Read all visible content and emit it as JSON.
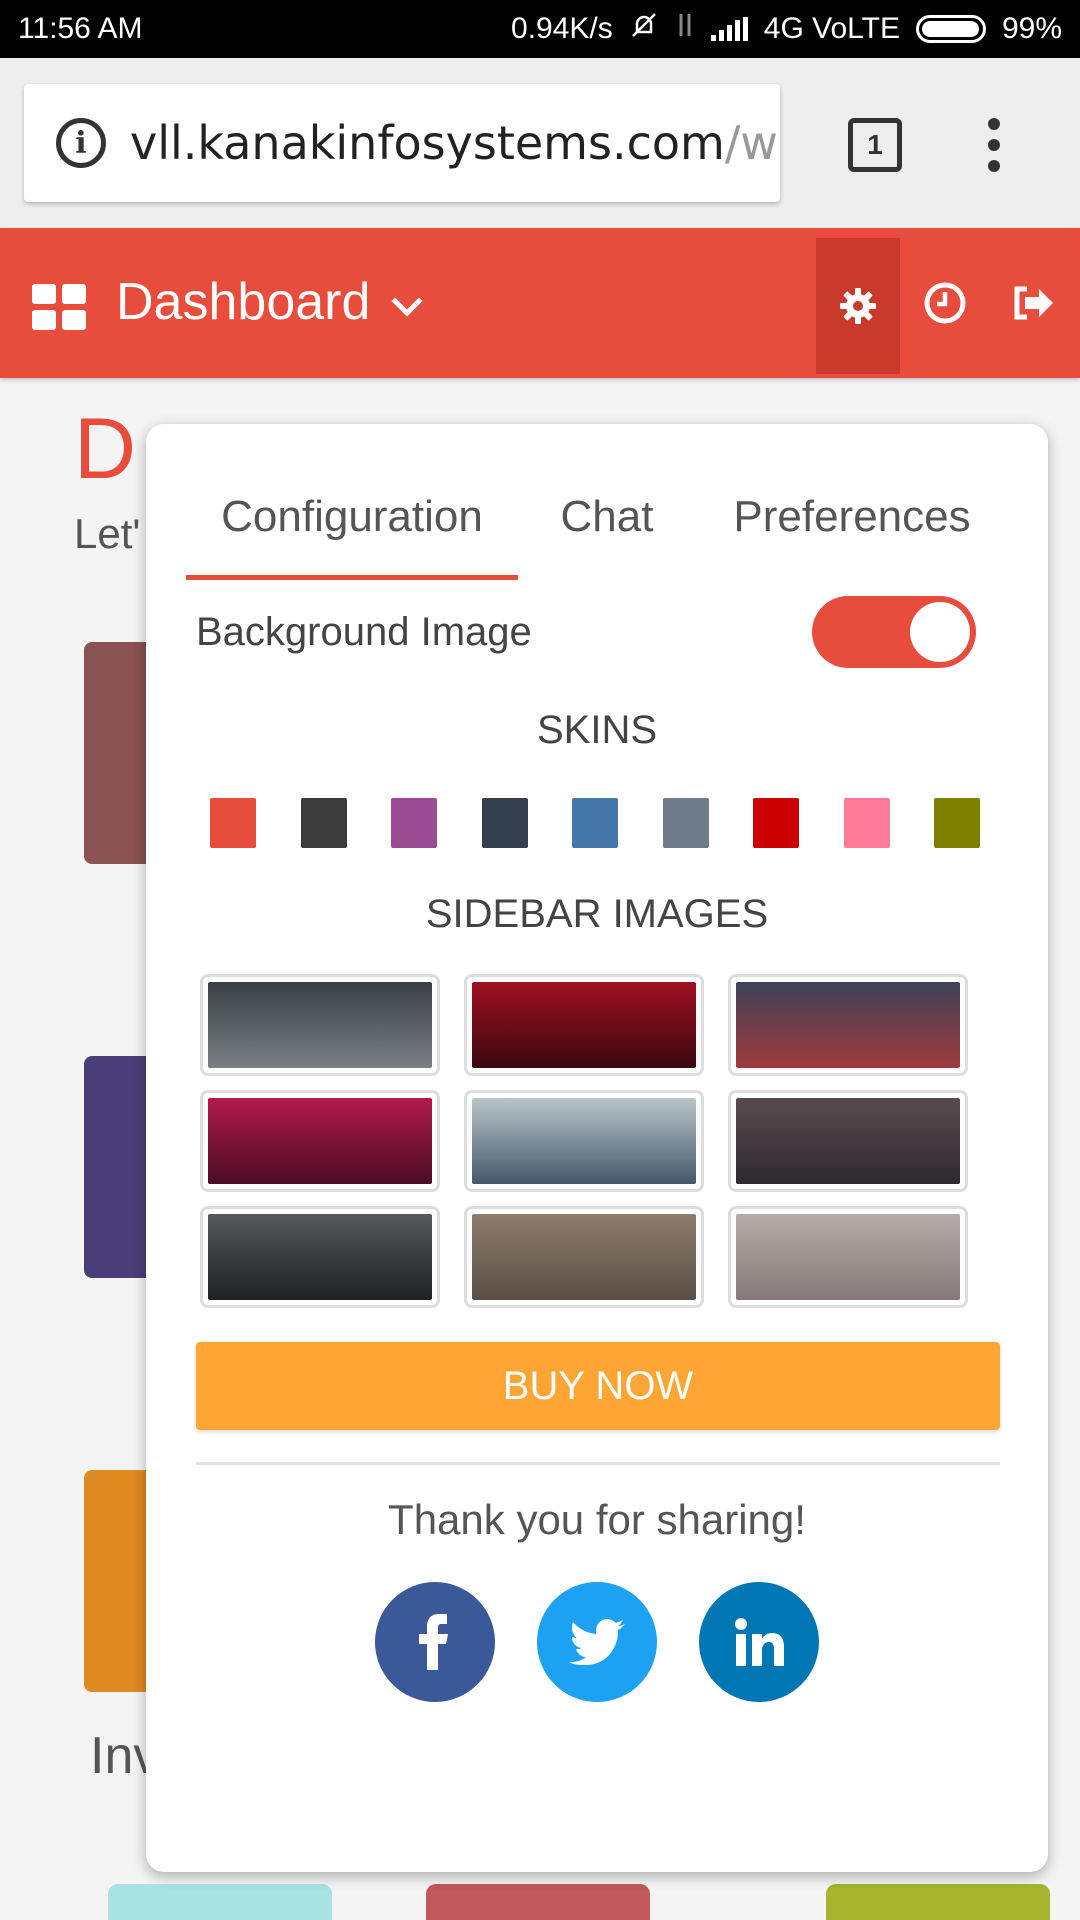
{
  "status_bar": {
    "time": "11:56 AM",
    "net_speed": "0.94K/s",
    "network": "4G VoLTE",
    "battery": "99%"
  },
  "browser": {
    "url_main": "vll.kanakinfosystems.com",
    "url_rest": "/w",
    "tab_count": "1"
  },
  "header": {
    "title": "Dashboard",
    "accent_color": "#e74c3c"
  },
  "background_page": {
    "title_fragment": "D",
    "subtitle_fragment": "Let'",
    "partial_label": "Inv"
  },
  "panel": {
    "tabs": [
      {
        "label": "Configuration",
        "active": true
      },
      {
        "label": "Chat",
        "active": false
      },
      {
        "label": "Preferences",
        "active": false
      }
    ],
    "background_image": {
      "label": "Background Image",
      "enabled": true
    },
    "skins_heading": "SKINS",
    "skins": [
      "#e74c3c",
      "#3c3c3c",
      "#9b4a96",
      "#34404f",
      "#4577a8",
      "#6e7b89",
      "#cc0000",
      "#ff7b97",
      "#7f8000"
    ],
    "sidebar_images_heading": "SIDEBAR IMAGES",
    "sidebar_images": [
      {
        "name": "snowy-mountain-hiker",
        "colors": [
          "#3b3f44",
          "#7a8086"
        ]
      },
      {
        "name": "red-sky",
        "colors": [
          "#a01020",
          "#3a0810"
        ]
      },
      {
        "name": "mountains-red-sunset",
        "colors": [
          "#3d4258",
          "#a03a3a"
        ]
      },
      {
        "name": "magenta-mountains",
        "colors": [
          "#b21a4e",
          "#4a0c22"
        ]
      },
      {
        "name": "cloudy-valley",
        "colors": [
          "#b8c4c8",
          "#44586a"
        ]
      },
      {
        "name": "city-skyline-dusk",
        "colors": [
          "#5a4a4e",
          "#2e2a30"
        ]
      },
      {
        "name": "dark-mountain-pass",
        "colors": [
          "#55595c",
          "#1e2022"
        ]
      },
      {
        "name": "brown-gradient",
        "colors": [
          "#8c7d6e",
          "#5b4e44"
        ]
      },
      {
        "name": "grey-gradient",
        "colors": [
          "#b8acab",
          "#857878"
        ]
      }
    ],
    "buy_button": "BUY NOW",
    "thanks_text": "Thank you for sharing!",
    "socials": [
      {
        "name": "facebook",
        "glyph": "f",
        "color": "#3b5998"
      },
      {
        "name": "twitter",
        "glyph": "t",
        "color": "#1da1f2"
      },
      {
        "name": "linkedin",
        "glyph": "in",
        "color": "#0077b5"
      }
    ]
  }
}
